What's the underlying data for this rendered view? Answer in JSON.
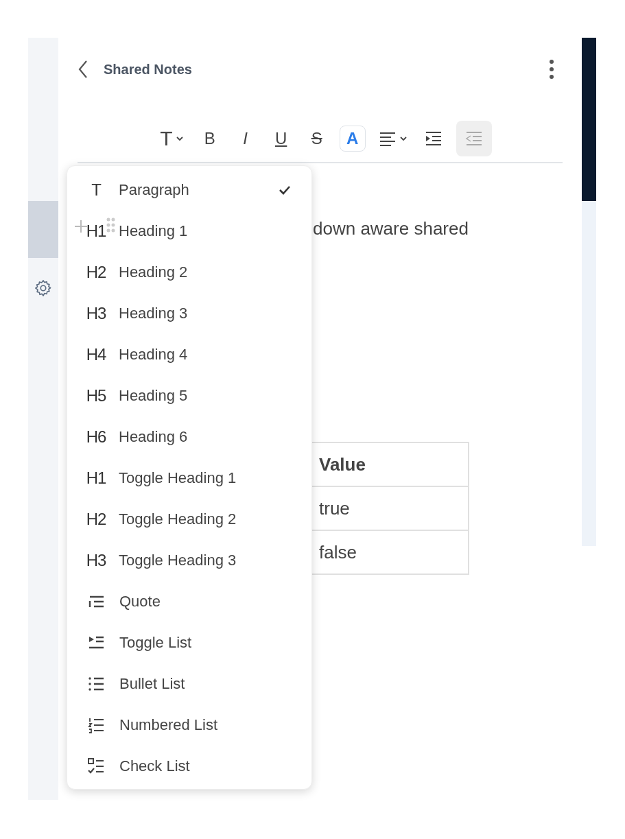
{
  "header": {
    "title": "Shared Notes"
  },
  "toolbar": [
    {
      "kind": "glyph",
      "label": "T",
      "dropdown": true,
      "selected": false,
      "disabled": false
    },
    {
      "kind": "bold",
      "label": "B",
      "dropdown": false,
      "selected": false,
      "disabled": false
    },
    {
      "kind": "italic",
      "label": "I",
      "dropdown": false,
      "selected": false,
      "disabled": false
    },
    {
      "kind": "underline",
      "label": "U",
      "dropdown": false,
      "selected": false,
      "disabled": false
    },
    {
      "kind": "strike",
      "label": "S",
      "dropdown": false,
      "selected": false,
      "disabled": false
    },
    {
      "kind": "color",
      "label": "A",
      "dropdown": false,
      "selected": true,
      "disabled": false
    },
    {
      "kind": "align",
      "dropdown": true,
      "selected": false,
      "disabled": false
    },
    {
      "kind": "indent",
      "dropdown": false,
      "selected": false,
      "disabled": false
    },
    {
      "kind": "outdent",
      "dropdown": false,
      "selected": false,
      "disabled": true
    }
  ],
  "editor": {
    "paragraph": "down aware shared",
    "table": {
      "header": [
        "Value"
      ],
      "rows": [
        [
          "true"
        ],
        [
          "false"
        ]
      ]
    }
  },
  "block_menu": [
    {
      "kind": "glyph",
      "icon_text": "T",
      "label": "Paragraph",
      "selected": true
    },
    {
      "kind": "glyph",
      "icon_text": "H1",
      "label": "Heading 1",
      "selected": false
    },
    {
      "kind": "glyph",
      "icon_text": "H2",
      "label": "Heading 2",
      "selected": false
    },
    {
      "kind": "glyph",
      "icon_text": "H3",
      "label": "Heading 3",
      "selected": false
    },
    {
      "kind": "glyph",
      "icon_text": "H4",
      "label": "Heading 4",
      "selected": false
    },
    {
      "kind": "glyph",
      "icon_text": "H5",
      "label": "Heading 5",
      "selected": false
    },
    {
      "kind": "glyph",
      "icon_text": "H6",
      "label": "Heading 6",
      "selected": false
    },
    {
      "kind": "glyph",
      "icon_text": "H1",
      "label": "Toggle Heading 1",
      "selected": false
    },
    {
      "kind": "glyph",
      "icon_text": "H2",
      "label": "Toggle Heading 2",
      "selected": false
    },
    {
      "kind": "glyph",
      "icon_text": "H3",
      "label": "Toggle Heading 3",
      "selected": false
    },
    {
      "kind": "quote",
      "label": "Quote",
      "selected": false
    },
    {
      "kind": "toggle_list",
      "label": "Toggle List",
      "selected": false
    },
    {
      "kind": "bullet_list",
      "label": "Bullet List",
      "selected": false
    },
    {
      "kind": "numbered_list",
      "label": "Numbered List",
      "selected": false
    },
    {
      "kind": "check_list",
      "label": "Check List",
      "selected": false
    }
  ]
}
